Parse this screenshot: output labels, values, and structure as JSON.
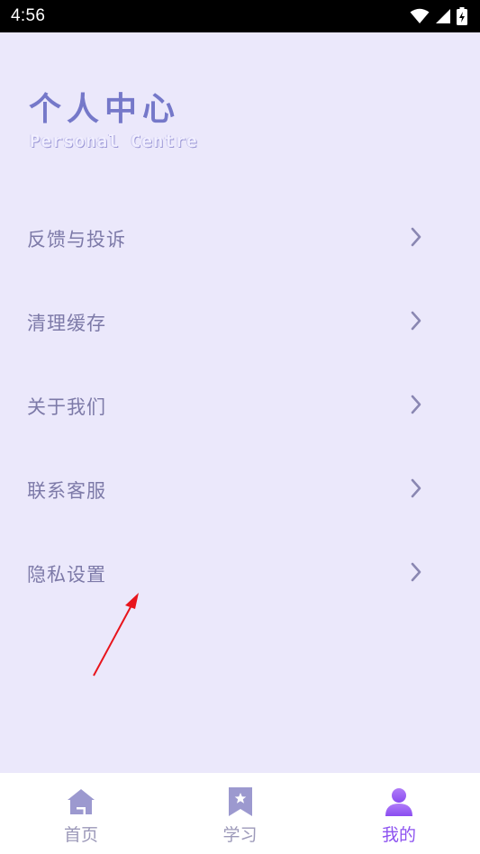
{
  "status_bar": {
    "time": "4:56"
  },
  "header": {
    "title": "个人中心",
    "subtitle": "Personal Centre"
  },
  "menu": {
    "items": [
      {
        "label": "反馈与投诉"
      },
      {
        "label": "清理缓存"
      },
      {
        "label": "关于我们"
      },
      {
        "label": "联系客服"
      },
      {
        "label": "隐私设置"
      }
    ]
  },
  "bottom_nav": {
    "items": [
      {
        "label": "首页",
        "icon": "home-icon"
      },
      {
        "label": "学习",
        "icon": "bookmark-star-icon"
      },
      {
        "label": "我的",
        "icon": "user-icon",
        "active": true
      }
    ]
  },
  "colors": {
    "background": "#ebe8fb",
    "accent": "#8d53f0",
    "title": "#7578c9",
    "menu_text": "#7d7aa8",
    "annotation_arrow": "#e8141c"
  }
}
